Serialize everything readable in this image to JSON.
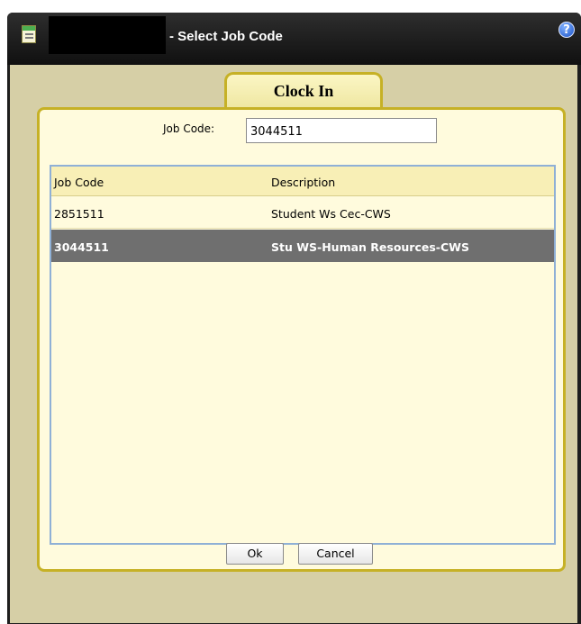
{
  "window": {
    "title": "- Select Job Code",
    "help_glyph": "?"
  },
  "tab": {
    "label": "Clock In"
  },
  "form": {
    "job_code_label": "Job Code:",
    "job_code_value": "3044511"
  },
  "grid": {
    "columns": [
      "Job Code",
      "Description"
    ],
    "rows": [
      {
        "code": "2851511",
        "description": "Student Ws Cec-CWS",
        "selected": false
      },
      {
        "code": "3044511",
        "description": "Stu WS-Human Resources-CWS",
        "selected": true
      }
    ]
  },
  "buttons": {
    "ok": "Ok",
    "cancel": "Cancel"
  },
  "colors": {
    "accent_gold": "#c6b126",
    "panel_bg": "#fffbdd",
    "selected_row": "#6f6f6f",
    "grid_border": "#8fb0d6"
  },
  "icons": {
    "app": "notepad-icon",
    "help": "help-icon"
  }
}
